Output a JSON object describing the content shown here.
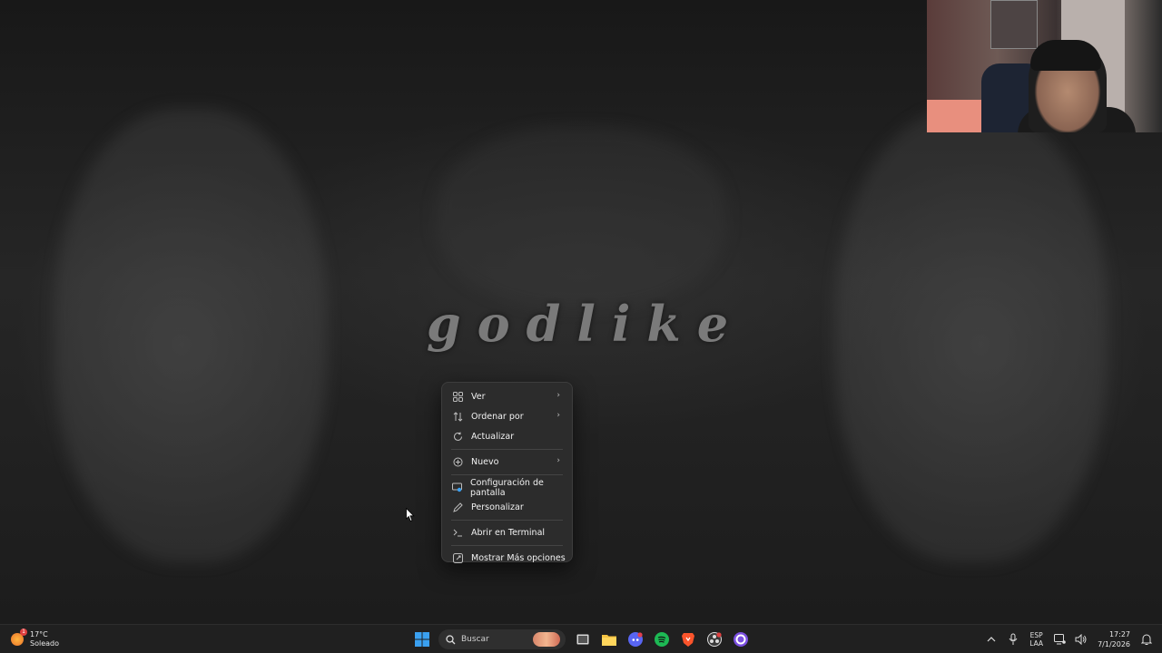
{
  "desktop": {
    "wallpaper_text": "godlike"
  },
  "context_menu": {
    "items": [
      {
        "label": "Ver",
        "icon": "view-grid-icon",
        "submenu": true
      },
      {
        "label": "Ordenar por",
        "icon": "sort-icon",
        "submenu": true
      },
      {
        "label": "Actualizar",
        "icon": "refresh-icon",
        "submenu": false
      },
      {
        "label": "Nuevo",
        "icon": "new-plus-icon",
        "submenu": true
      },
      {
        "label": "Configuración de pantalla",
        "icon": "display-settings-icon",
        "submenu": false
      },
      {
        "label": "Personalizar",
        "icon": "pen-icon",
        "submenu": false
      },
      {
        "label": "Abrir en Terminal",
        "icon": "terminal-icon",
        "submenu": false
      },
      {
        "label": "Mostrar Más opciones",
        "icon": "more-options-icon",
        "submenu": false
      }
    ],
    "submenu_arrow": "›"
  },
  "taskbar": {
    "weather": {
      "temperature": "17°C",
      "condition": "Soleado",
      "badge": "1"
    },
    "search": {
      "placeholder": "Buscar"
    },
    "apps": [
      "start-icon",
      "task-view-icon",
      "file-explorer-icon",
      "discord-icon",
      "spotify-icon",
      "brave-icon",
      "obs-icon",
      "cortana-icon"
    ],
    "tray": {
      "language_line1": "ESP",
      "language_line2": "LAA",
      "time": "17:27",
      "date": "7/1/2026"
    }
  },
  "colors": {
    "menu_bg": "#2c2c2c",
    "taskbar_bg": "#202020",
    "accent_windows": "#3aa0f0",
    "spotify": "#1db954",
    "discord": "#5865f2",
    "brave": "#fb542b"
  }
}
